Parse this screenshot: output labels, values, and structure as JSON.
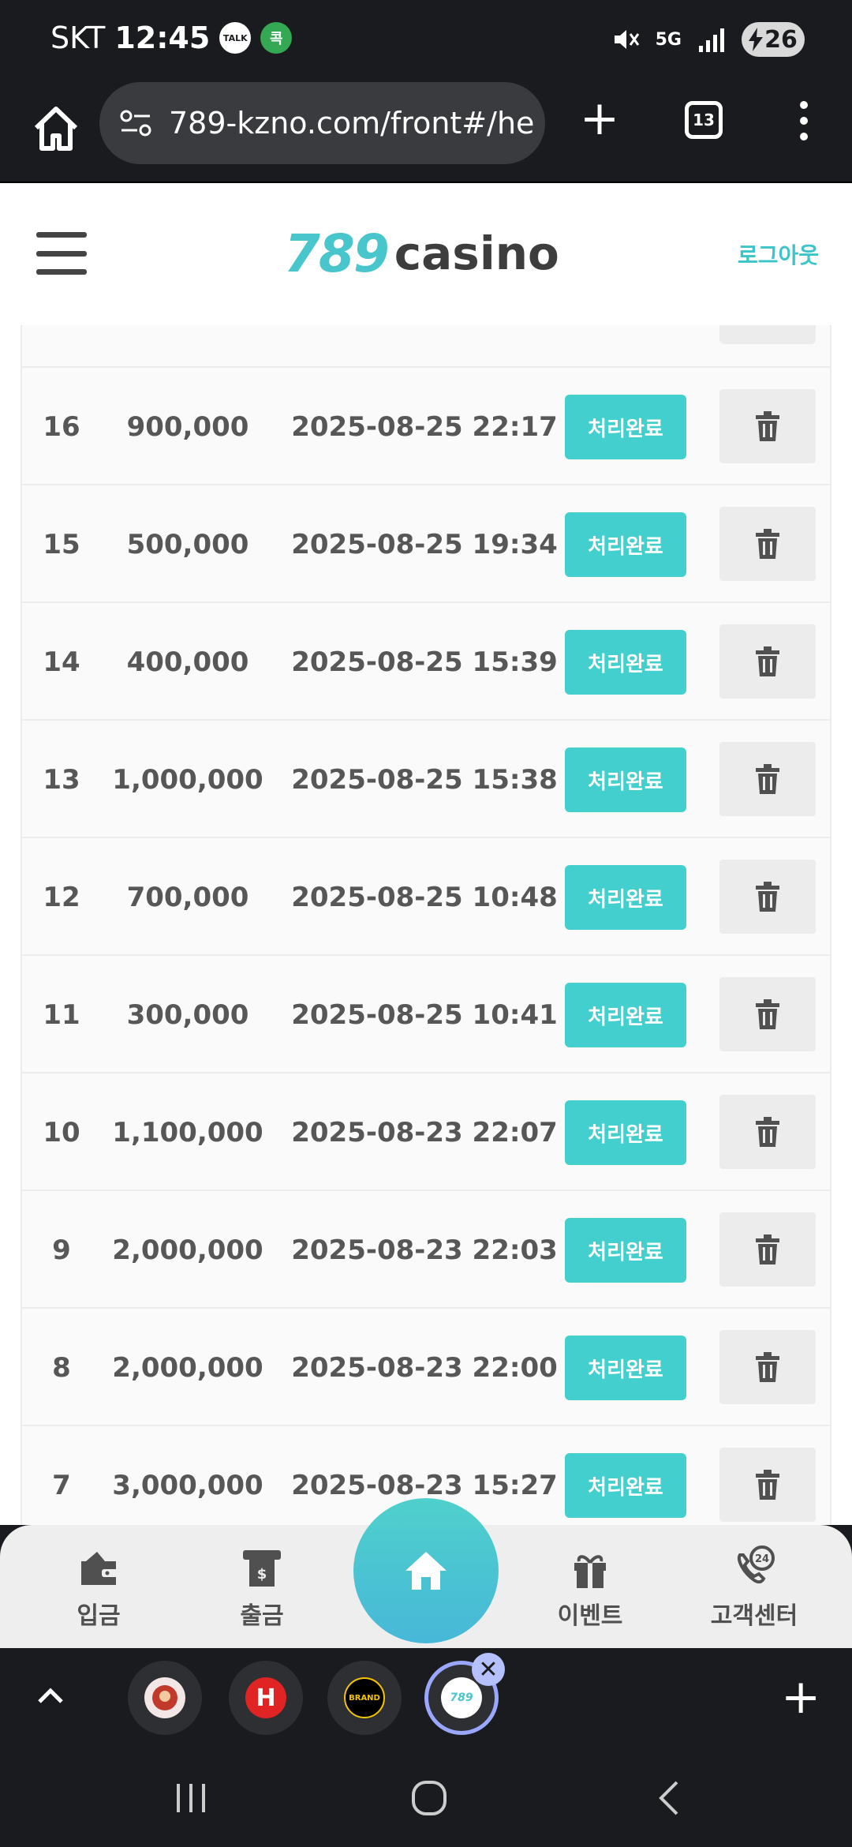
{
  "status_bar": {
    "carrier": "SKT",
    "time": "12:45",
    "talk_badge": "TALK",
    "app_badge": "콕",
    "network": "5G",
    "battery": "26"
  },
  "browser": {
    "url": "789-kzno.com/front#/he",
    "tab_count": "13"
  },
  "site": {
    "logo_number": "789",
    "logo_word": "casino",
    "logout_label": "로그아웃"
  },
  "rows": [
    {
      "no": "16",
      "amount": "900,000",
      "date": "2025-08-25 22:17",
      "status": "처리완료"
    },
    {
      "no": "15",
      "amount": "500,000",
      "date": "2025-08-25 19:34",
      "status": "처리완료"
    },
    {
      "no": "14",
      "amount": "400,000",
      "date": "2025-08-25 15:39",
      "status": "처리완료"
    },
    {
      "no": "13",
      "amount": "1,000,000",
      "date": "2025-08-25 15:38",
      "status": "처리완료"
    },
    {
      "no": "12",
      "amount": "700,000",
      "date": "2025-08-25 10:48",
      "status": "처리완료"
    },
    {
      "no": "11",
      "amount": "300,000",
      "date": "2025-08-25 10:41",
      "status": "처리완료"
    },
    {
      "no": "10",
      "amount": "1,100,000",
      "date": "2025-08-23 22:07",
      "status": "처리완료"
    },
    {
      "no": "9",
      "amount": "2,000,000",
      "date": "2025-08-23 22:03",
      "status": "처리완료"
    },
    {
      "no": "8",
      "amount": "2,000,000",
      "date": "2025-08-23 22:00",
      "status": "처리완료"
    },
    {
      "no": "7",
      "amount": "3,000,000",
      "date": "2025-08-23 15:27",
      "status": "처리완료"
    }
  ],
  "bottom_nav": {
    "deposit": "입금",
    "withdraw": "출금",
    "event": "이벤트",
    "support": "고객센터",
    "support_badge": "24"
  },
  "tab_strip": {
    "brand_tab_label": "BRAND",
    "active_tab_label": "789"
  },
  "colors": {
    "accent": "#44cfcf",
    "text": "#575757",
    "dark_bg": "#1a1b1f"
  }
}
